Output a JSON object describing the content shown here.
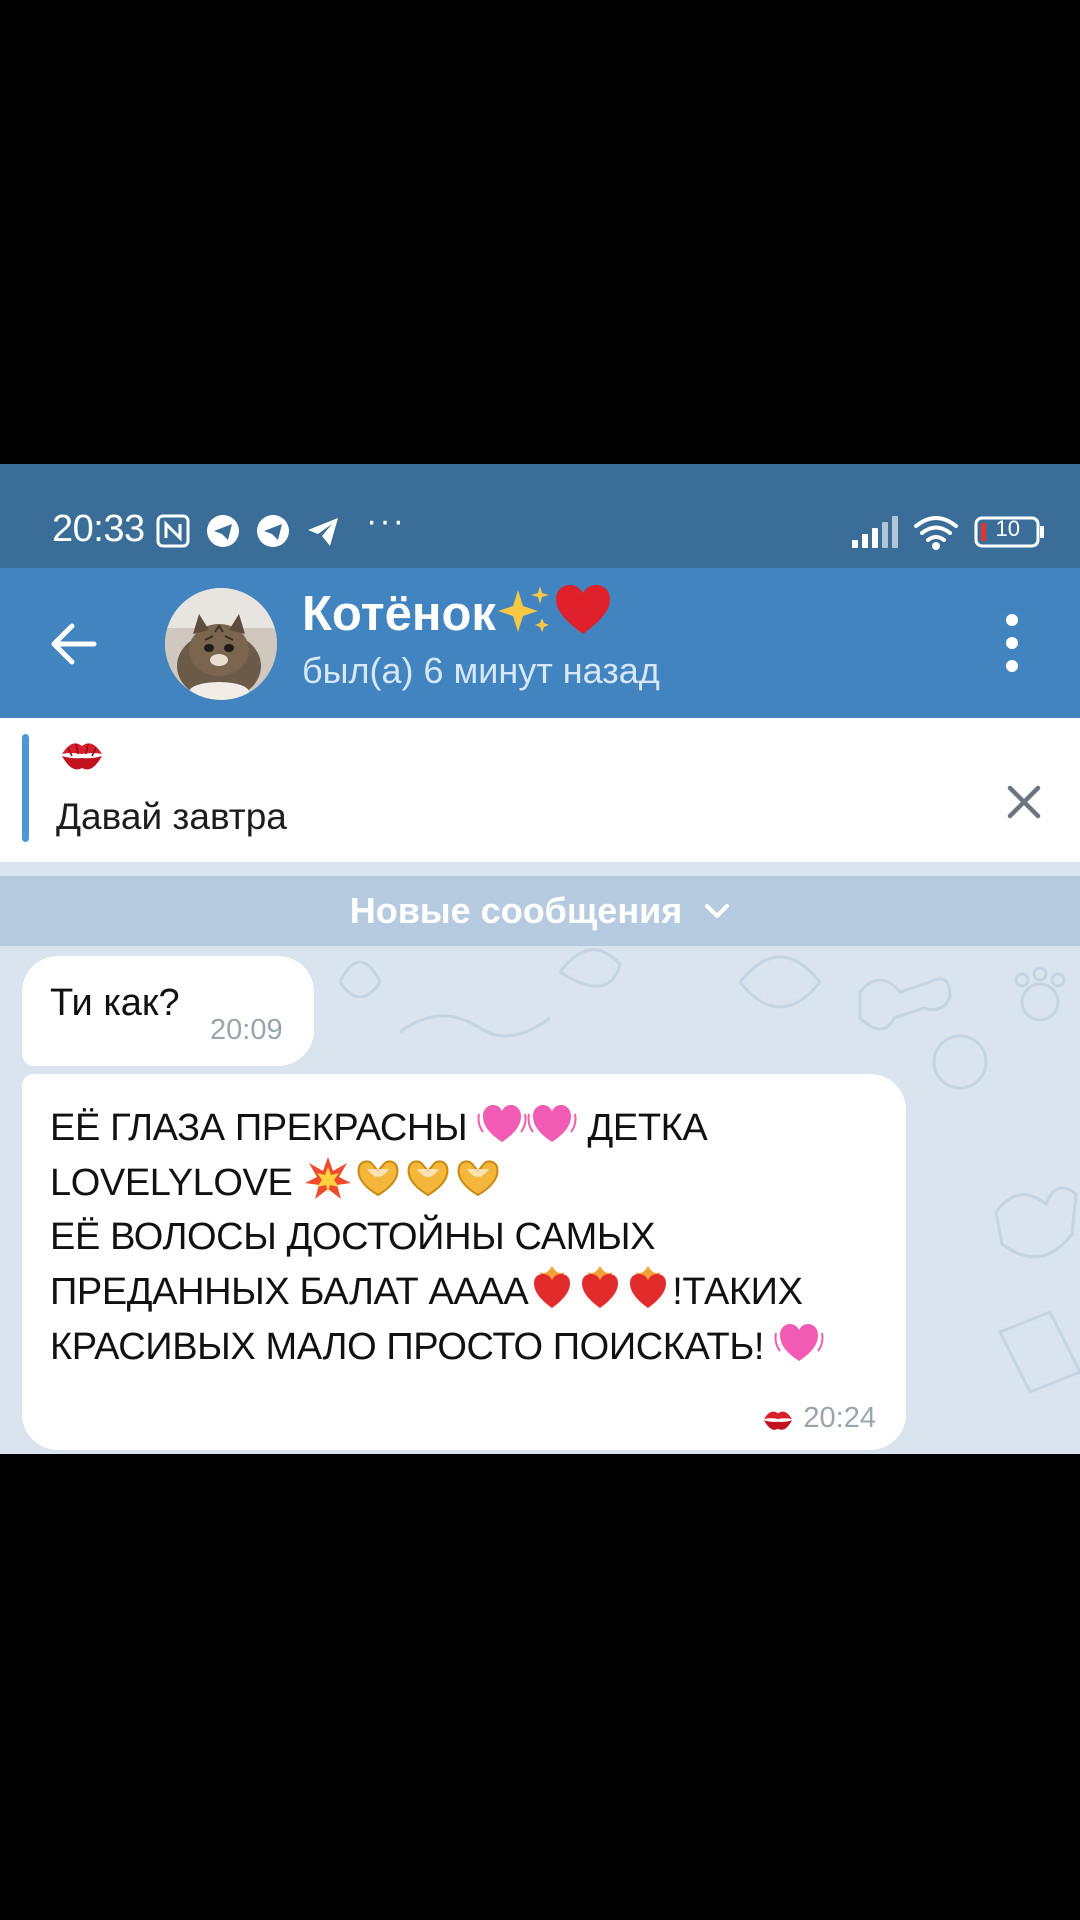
{
  "status_bar": {
    "time": "20:33",
    "battery": "10",
    "icons": [
      "nfc-icon",
      "telegram-icon",
      "telegram-icon",
      "telegram-send-icon",
      "more-dots-icon",
      "signal-icon",
      "wifi-icon",
      "battery-icon"
    ],
    "dots": "···"
  },
  "header": {
    "title": "Котёнок",
    "title_emojis": [
      "sparkles",
      "red-heart"
    ],
    "subtitle": "был(а) 6 минут назад"
  },
  "pinned": {
    "emoji": "kiss-mark",
    "text": "Давай завтра"
  },
  "banner": {
    "label": "Новые сообщения"
  },
  "messages": [
    {
      "text": "Ти как?",
      "time": "20:09"
    },
    {
      "lines": [
        "ЕЁ ГЛАЗА ПРЕКРАСНЫ",
        "ДЕТКА",
        "LOVELYLOVE",
        "ЕЁ ВОЛОСЫ ДОСТОЙНЫ САМЫХ",
        "ПРЕДАННЫХ БАЛАТ АААА",
        "!ТАКИХ",
        "КРАСИВЫХ МАЛО ПРОСТО ПОИСКАТЬ!"
      ],
      "reaction": "kiss-mark",
      "time": "20:24"
    }
  ],
  "colors": {
    "status_bar": "#3a6e98",
    "header": "#4284bf",
    "chat_bg": "#d9e4ee",
    "banner": "#b7cbe0",
    "accent": "#4c96d9"
  }
}
